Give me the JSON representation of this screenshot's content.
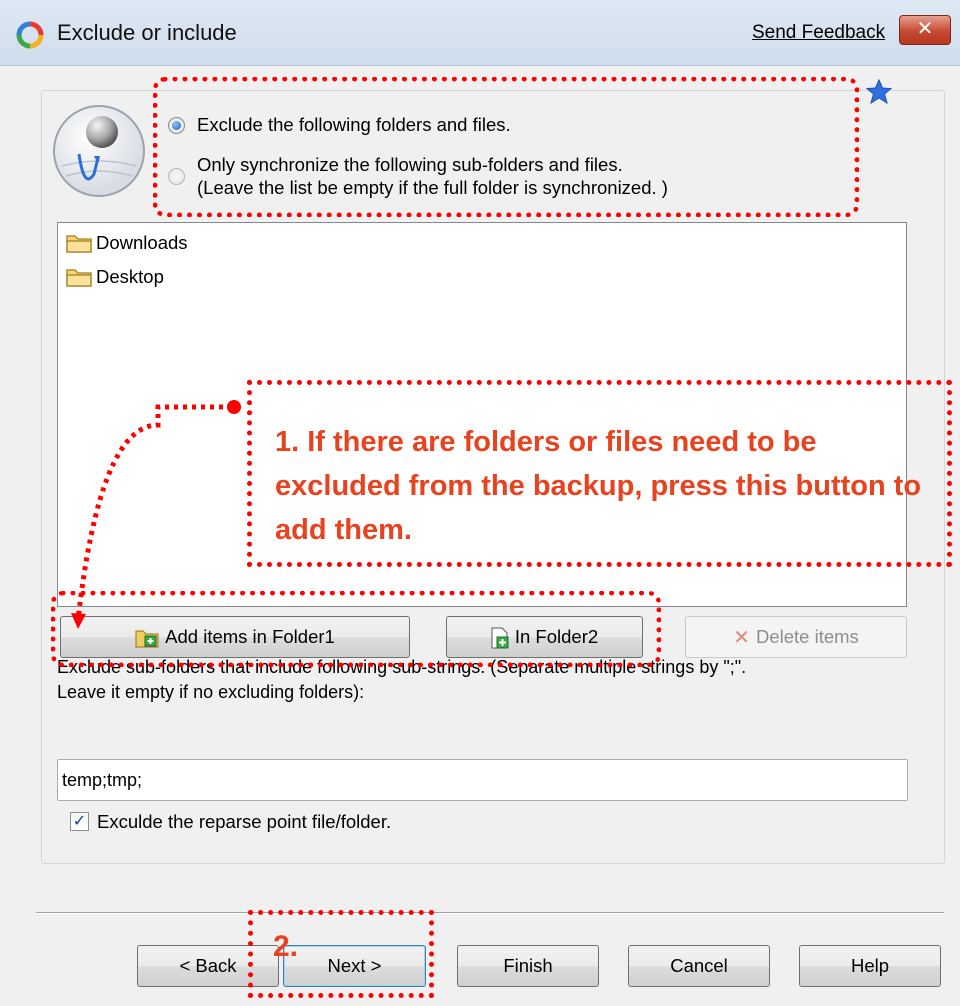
{
  "window": {
    "title": "Exclude or include",
    "send_feedback": "Send Feedback",
    "close_glyph": "✕"
  },
  "options": {
    "exclude_label": "Exclude the following folders and files.",
    "only_sync_label_line1": "Only synchronize the following sub-folders and files.",
    "only_sync_label_line2": "(Leave the list be empty if the full folder is synchronized. )",
    "selected": "exclude"
  },
  "list": {
    "items": [
      {
        "label": "Downloads",
        "icon": "folder-icon"
      },
      {
        "label": "Desktop",
        "icon": "folder-icon"
      }
    ]
  },
  "buttons": {
    "add_folder1": "Add items in Folder1",
    "in_folder2": "In Folder2",
    "delete_items": "Delete items"
  },
  "exclude_substrings": {
    "description_line1": "Exclude sub-folders that include following sub-strings. (Separate multiple strings by \";\".",
    "description_line2": "Leave it empty if no excluding folders):",
    "value": "temp;tmp;"
  },
  "reparse": {
    "label": "Exculde the reparse point file/folder.",
    "checked": true
  },
  "nav": {
    "back": "< Back",
    "next": "Next >",
    "finish": "Finish",
    "cancel": "Cancel",
    "help": "Help"
  },
  "annotations": {
    "step1": "1. If there are folders or files need to be excluded from the backup, press  this button to add them.",
    "step2": "2."
  },
  "colors": {
    "annotation_red": "#ff0000",
    "annotation_text": "#e8421f",
    "star": "#2f6fe0"
  }
}
